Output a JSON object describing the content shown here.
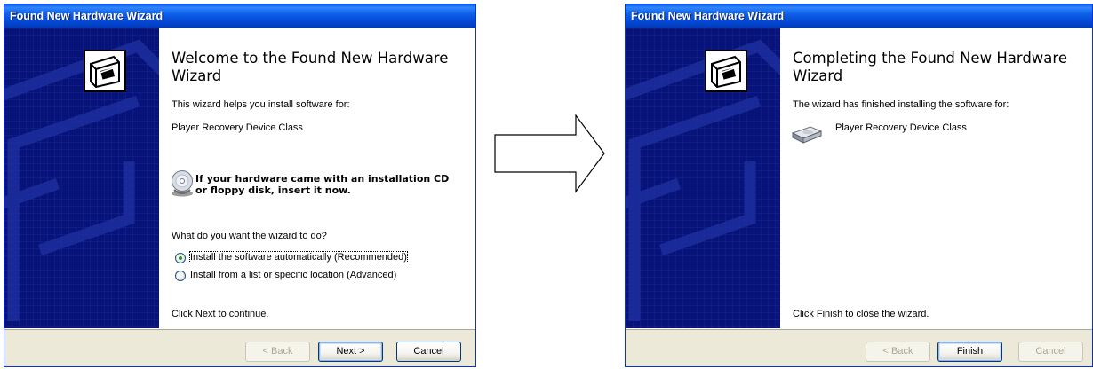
{
  "left_wizard": {
    "title": "Found New Hardware Wizard",
    "heading": "Welcome to the Found New Hardware Wizard",
    "intro": "This wizard helps you install software for:",
    "device": "Player Recovery Device Class",
    "cd_prompt_line1": "If your hardware came with an installation CD",
    "cd_prompt_line2": "or floppy disk, insert it now.",
    "question": "What do you want the wizard to do?",
    "options": [
      {
        "label": "Install the software automatically (Recommended)",
        "selected": true
      },
      {
        "label": "Install from a list or specific location (Advanced)",
        "selected": false
      }
    ],
    "continue_text": "Click Next to continue.",
    "buttons": {
      "back": "< Back",
      "next": "Next >",
      "cancel": "Cancel"
    }
  },
  "right_wizard": {
    "title": "Found New Hardware Wizard",
    "heading": "Completing the Found New Hardware Wizard",
    "finished_text": "The wizard has finished installing the software for:",
    "device": "Player Recovery Device Class",
    "close_text": "Click Finish to close the wizard.",
    "buttons": {
      "back": "< Back",
      "finish": "Finish",
      "cancel": "Cancel"
    }
  },
  "icons": {
    "hardware": "hardware-wizard-icon",
    "cd": "cd-disk-icon",
    "device": "device-drive-icon",
    "transition": "right-arrow-icon"
  },
  "colors": {
    "title_bar": "#0246d2",
    "sidebar": "#08137a",
    "button_face": "#ece9d8",
    "radio_dot": "#21a121"
  }
}
